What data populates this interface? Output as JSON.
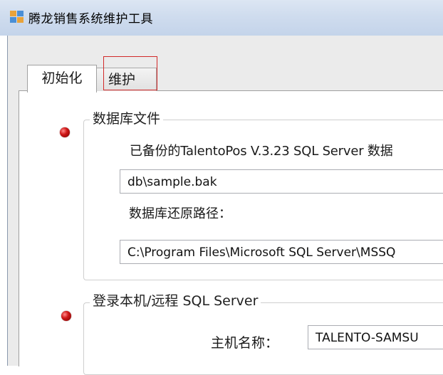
{
  "window": {
    "title": "腾龙销售系统维护工具"
  },
  "tabs": [
    {
      "label": "初始化",
      "active": true
    },
    {
      "label": "维护",
      "active": false
    }
  ],
  "database_file_group": {
    "legend": "数据库文件",
    "backup_label": "已备份的TalentoPos V.3.23 SQL Server 数据",
    "backup_path_value": "db\\sample.bak",
    "restore_path_label": "数据库还原路径：",
    "restore_path_value": "C:\\Program Files\\Microsoft SQL Server\\MSSQ"
  },
  "login_group": {
    "legend": "登录本机/远程 SQL Server",
    "host_label": "主机名称：",
    "host_value": "TALENTO-SAMSU"
  },
  "colors": {
    "title_bar": "#cfdcee",
    "window_bg": "#ebebeb",
    "bullet": "#d01818",
    "focus_outline": "#d22a2a"
  }
}
